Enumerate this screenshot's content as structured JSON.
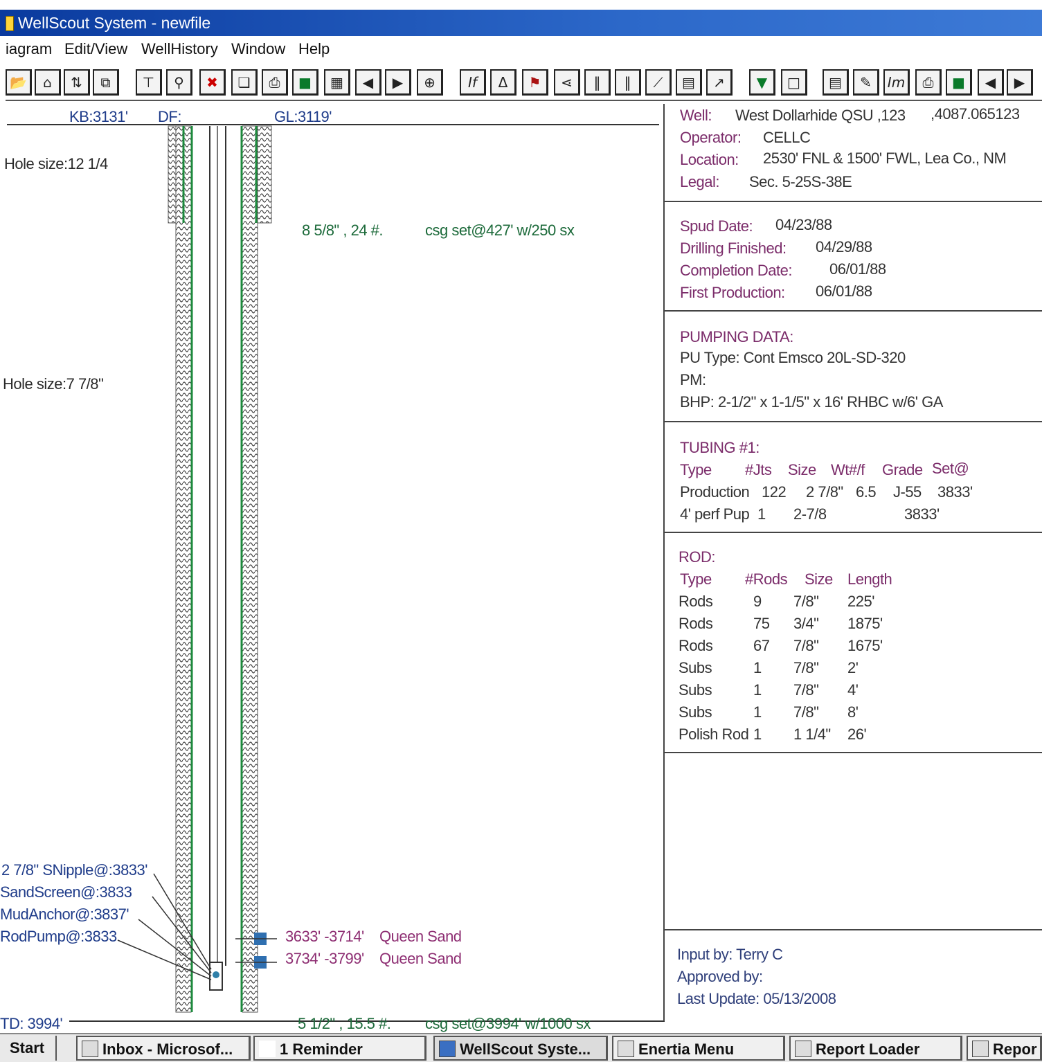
{
  "window": {
    "title": "WellScout System - newfile"
  },
  "menu": [
    "iagram",
    "Edit/View",
    "WellHistory",
    "Window",
    "Help"
  ],
  "toolbar_icons": [
    "open-icon",
    "home-icon",
    "sort-icon",
    "copy-icon",
    "tubing-icon",
    "zoom-icon",
    "delete-icon",
    "pages-icon",
    "print-icon",
    "color-icon",
    "grid-icon",
    "prev-icon",
    "next-icon",
    "wellhead-icon",
    "info-icon",
    "derrick-icon",
    "boot-icon",
    "valve-icon",
    "bars1-icon",
    "bars2-icon",
    "line-icon",
    "notes-icon",
    "tool-icon",
    "shield-icon",
    "blank-icon",
    "chart-icon",
    "edit-icon",
    "im-icon",
    "print2-icon",
    "color2-icon",
    "prev2-icon",
    "next2-icon"
  ],
  "diagram": {
    "kb": "KB:3131'",
    "df": "DF:",
    "gl": "GL:3119'",
    "hole_size_1": "Hole size:12 1/4",
    "hole_size_2": "Hole size:7 7/8\"",
    "casing1_size": "8 5/8\" , 24  #.",
    "casing1_set": "csg set@427'  w/250  sx",
    "snipple": "2 7/8\" SNipple@:3833'",
    "sandscreen": "SandScreen@:3833",
    "mudanchor": "MudAnchor@:3837'",
    "rodpump": "RodPump@:3833",
    "perf1_range": "3633'  -3714'",
    "perf1_name": "Queen Sand",
    "perf2_range": "3734'  -3799'",
    "perf2_name": "Queen Sand",
    "td": "TD:  3994'",
    "casing2_size": "5 1/2\" , 15.5 #.",
    "casing2_set": "csg set@3994' w/1000  sx"
  },
  "well_info": {
    "well_label": "Well:",
    "well_value": "West Dollarhide QSU ,123",
    "api": ",4087.065123",
    "operator_label": "Operator:",
    "operator_value": "CELLC",
    "location_label": "Location:",
    "location_value": "2530' FNL & 1500' FWL, Lea Co., NM",
    "legal_label": "Legal:",
    "legal_value": "Sec. 5-25S-38E"
  },
  "dates": {
    "spud_label": "Spud Date:",
    "spud_value": "04/23/88",
    "drilling_label": "Drilling Finished:",
    "drilling_value": "04/29/88",
    "completion_label": "Completion Date:",
    "completion_value": "06/01/88",
    "first_prod_label": "First Production:",
    "first_prod_value": "06/01/88"
  },
  "pumping": {
    "heading": "PUMPING DATA:",
    "pu_type": "PU Type: Cont Emsco 20L-SD-320",
    "pm": "PM:",
    "bhp": "BHP: 2-1/2\" x 1-1/5\" x 16' RHBC w/6' GA"
  },
  "tubing": {
    "heading": "TUBING #1:",
    "columns": [
      "Type",
      "#Jts",
      "Size",
      "Wt#/f",
      "Grade",
      "Set@"
    ],
    "rows": [
      [
        "Production",
        "122",
        "2 7/8\"",
        "6.5",
        "J-55",
        "3833'"
      ],
      [
        "4' perf Pup",
        "1",
        "2-7/8",
        "",
        "",
        "3833'"
      ]
    ]
  },
  "rod": {
    "heading": "ROD:",
    "columns": [
      "Type",
      "#Rods",
      "Size",
      "Length"
    ],
    "rows": [
      [
        "Rods",
        "9",
        "7/8\"",
        "225'"
      ],
      [
        "Rods",
        "75",
        "3/4\"",
        "1875'"
      ],
      [
        "Rods",
        "67",
        "7/8\"",
        "1675'"
      ],
      [
        "Subs",
        "1",
        "7/8\"",
        "2'"
      ],
      [
        "Subs",
        "1",
        "7/8\"",
        "4'"
      ],
      [
        "Subs",
        "1",
        "7/8\"",
        "8'"
      ],
      [
        "Polish Rod",
        "1",
        "1 1/4\"",
        "26'"
      ]
    ]
  },
  "footer_info": {
    "input_by": "Input by: Terry C",
    "approved_by": "Approved by:",
    "last_update": "Last Update: 05/13/2008"
  },
  "taskbar": {
    "start": "Start",
    "items": [
      "Inbox - Microsof...",
      "1 Reminder",
      "WellScout Syste...",
      "Enertia Menu",
      "Report Loader",
      "Repor"
    ]
  }
}
